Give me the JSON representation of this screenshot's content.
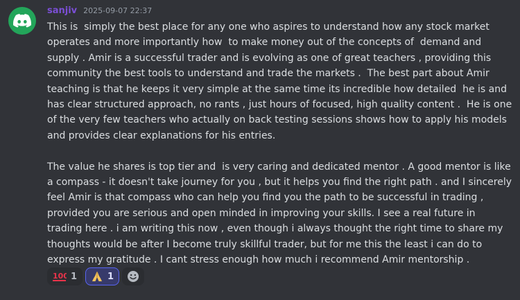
{
  "message": {
    "author": "sanjiv",
    "timestamp": "2025-09-07 22:37",
    "author_color": "#7b4fd6",
    "avatar_icon": "discord-logo-icon",
    "avatar_color": "#23a55a",
    "paragraphs": [
      "This is  simply the best place for any one who aspires to understand how any stock market operates and more importantly how  to make money out of the concepts of  demand and supply . Amir is a successful trader and is evolving as one of great teachers , providing this community the best tools to understand and trade the markets .  The best part about Amir teaching is that he keeps it very simple at the same time its incredible how detailed  he is and has clear structured approach, no rants , just hours of focused, high quality content .  He is one of the very few teachers who actually on back testing sessions shows how to apply his models and provides clear explanations for his entries.",
      "The value he shares is top tier and  is very caring and dedicated mentor . A good mentor is like a compass - it doesn't take journey for you , but it helps you find the right path . and I sincerely feel Amir is that compass who can help you find you the path to be successful in trading , provided you are serious and open minded in improving your skills. I see a real future in trading here . i am writing this now , even though i always thought the right time to share my thoughts would be after I become truly skillful trader, but for me this the least i can do to express my gratitude . I cant stress enough how much i recommend Amir mentorship ."
    ]
  },
  "reactions": [
    {
      "emoji": "💯",
      "icon": "hundred-points-icon",
      "count": "1",
      "active": false
    },
    {
      "emoji": "🙏",
      "icon": "folded-hands-icon",
      "count": "1",
      "active": true
    }
  ],
  "add_reaction_icon": "add-reaction-icon",
  "colors": {
    "background": "#313338",
    "text": "#dbdee1",
    "timestamp": "#949ba4",
    "reaction_bg": "#2b2d31",
    "reaction_active_bg": "#373a6b",
    "reaction_active_border": "#5865f2"
  }
}
